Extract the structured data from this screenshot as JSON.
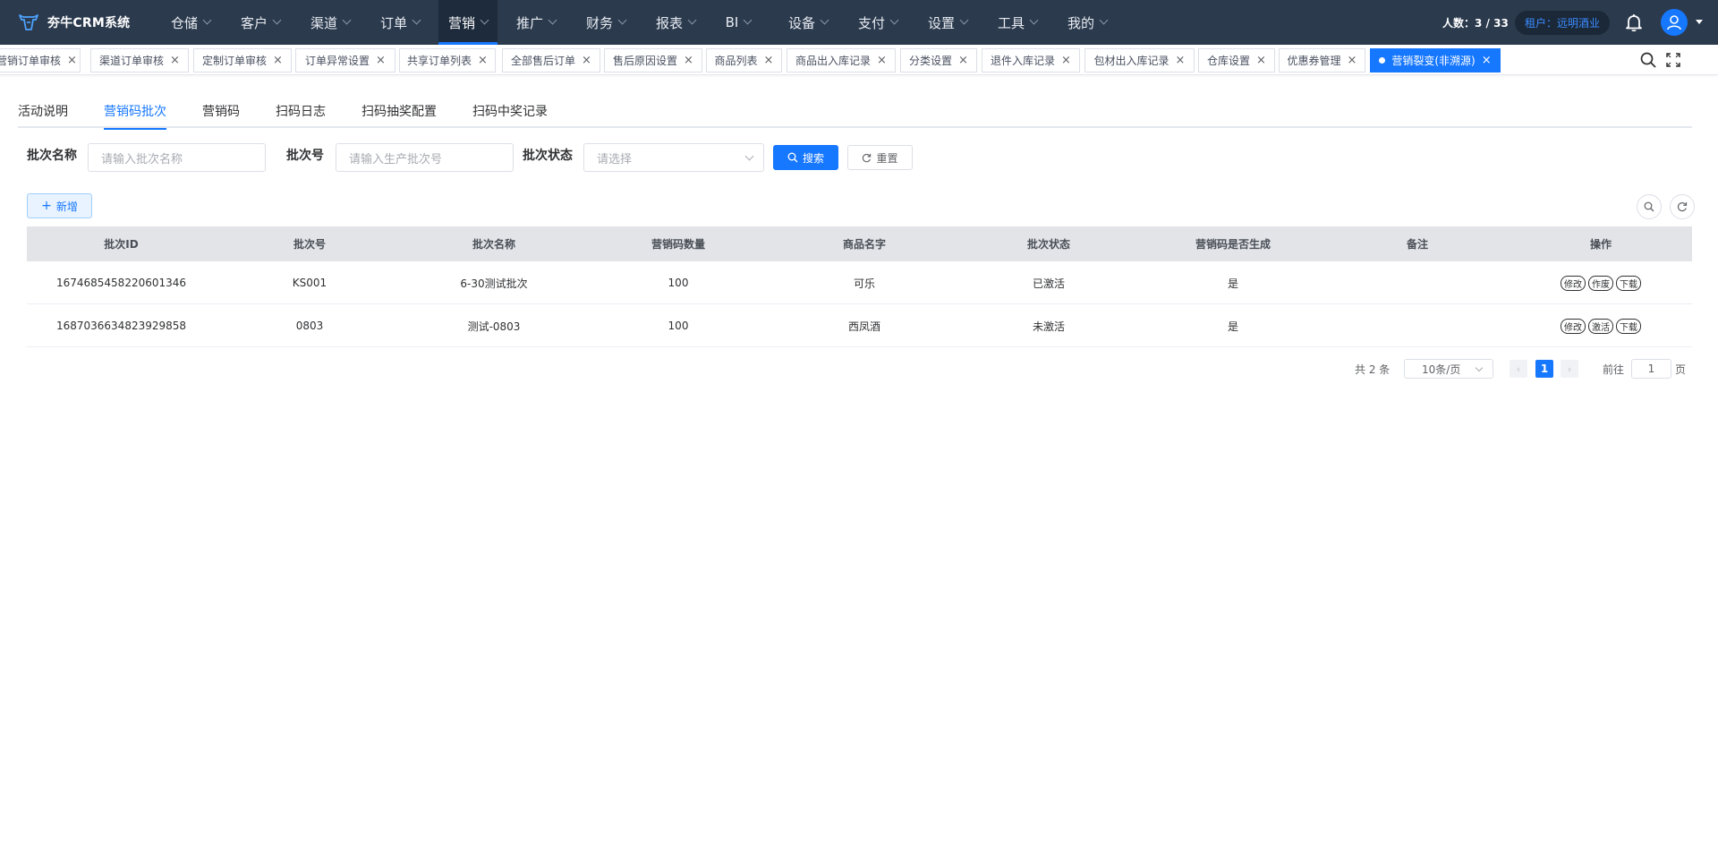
{
  "app": {
    "title": "夯牛CRM系统"
  },
  "nav": {
    "items": [
      {
        "label": "仓储",
        "active": false
      },
      {
        "label": "客户",
        "active": false
      },
      {
        "label": "渠道",
        "active": false
      },
      {
        "label": "订单",
        "active": false
      },
      {
        "label": "营销",
        "active": true
      },
      {
        "label": "推广",
        "active": false
      },
      {
        "label": "财务",
        "active": false
      },
      {
        "label": "报表",
        "active": false
      },
      {
        "label": "BI",
        "active": false
      },
      {
        "label": "设备",
        "active": false
      },
      {
        "label": "支付",
        "active": false
      },
      {
        "label": "设置",
        "active": false
      },
      {
        "label": "工具",
        "active": false
      },
      {
        "label": "我的",
        "active": false
      }
    ],
    "headcount": "人数：3 / 33",
    "tenant": "租户：远明酒业",
    "icons": [
      "bell-icon",
      "user-avatar-icon",
      "caret-down-icon"
    ]
  },
  "tabs": {
    "items": [
      {
        "label": "营销订单审核"
      },
      {
        "label": "渠道订单审核"
      },
      {
        "label": "定制订单审核"
      },
      {
        "label": "订单异常设置"
      },
      {
        "label": "共享订单列表"
      },
      {
        "label": "全部售后订单"
      },
      {
        "label": "售后原因设置"
      },
      {
        "label": "商品列表"
      },
      {
        "label": "商品出入库记录"
      },
      {
        "label": "分类设置"
      },
      {
        "label": "退件入库记录"
      },
      {
        "label": "包材出入库记录"
      },
      {
        "label": "仓库设置"
      },
      {
        "label": "优惠券管理"
      },
      {
        "label": "营销裂变(非溯源)"
      }
    ],
    "close_glyph": "×",
    "icons": [
      "search-icon",
      "fullscreen-icon"
    ]
  },
  "subtabs": {
    "items": [
      {
        "label": "活动说明"
      },
      {
        "label": "营销码批次"
      },
      {
        "label": "营销码"
      },
      {
        "label": "扫码日志"
      },
      {
        "label": "扫码抽奖配置"
      },
      {
        "label": "扫码中奖记录"
      }
    ],
    "active_index": 1
  },
  "filters": {
    "batch_name_label": "批次名称",
    "batch_name_placeholder": "请输入批次名称",
    "batch_no_label": "批次号",
    "batch_no_placeholder": "请输入生产批次号",
    "batch_status_label": "批次状态",
    "batch_status_placeholder": "请选择",
    "search_label": "搜索",
    "reset_label": "重置"
  },
  "toolbar": {
    "add_label": "新增",
    "icons": [
      "search-circle-icon",
      "refresh-circle-icon"
    ]
  },
  "table": {
    "columns": [
      "批次ID",
      "批次号",
      "批次名称",
      "营销码数量",
      "商品名字",
      "批次状态",
      "营销码是否生成",
      "备注",
      "操作"
    ],
    "rows": [
      {
        "batch_id": "1674685458220601346",
        "batch_no": "KS001",
        "batch_name": "6-30测试批次",
        "code_count": "100",
        "product_name": "可乐",
        "status": "已激活",
        "generated": "是",
        "remark": "",
        "actions": [
          "修改",
          "作废",
          "下载"
        ]
      },
      {
        "batch_id": "1687036634823929858",
        "batch_no": "0803",
        "batch_name": "测试-0803",
        "code_count": "100",
        "product_name": "西凤酒",
        "status": "未激活",
        "generated": "是",
        "remark": "",
        "actions": [
          "修改",
          "激活",
          "下载"
        ]
      }
    ]
  },
  "pagination": {
    "total": "共 2 条",
    "page_size": "10条/页",
    "current_page": "1",
    "goto_label": "前往",
    "goto_value": "1",
    "page_suffix": "页"
  },
  "colors": {
    "topbar": "#2b3a4d",
    "accent": "#1677ff",
    "table_header": "#e2e4e8"
  }
}
